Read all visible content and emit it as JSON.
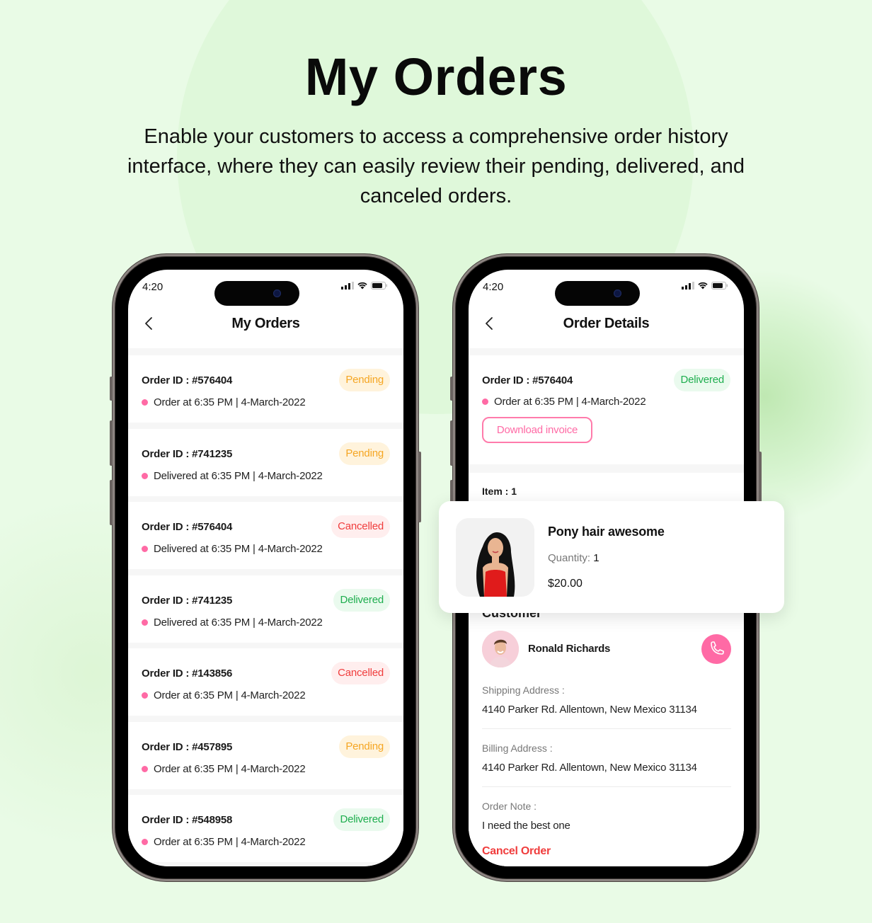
{
  "hero": {
    "title": "My Orders",
    "subtitle": "Enable your customers to access a comprehensive order history interface, where they can easily review their pending, delivered, and canceled orders."
  },
  "colors": {
    "accent_pink": "#ff6aa5",
    "pending": "#f5a623",
    "cancelled": "#f03d3d",
    "delivered": "#1fae4f",
    "background": "#e9fbe6"
  },
  "status_bar": {
    "time": "4:20",
    "icons": [
      "signal-icon",
      "wifi-icon",
      "battery-icon"
    ]
  },
  "orders_screen": {
    "title": "My Orders",
    "back_icon": "chevron-left-icon",
    "orders": [
      {
        "id_label": "Order ID : #576404",
        "meta": "Order at 6:35 PM | 4-March-2022",
        "status": "Pending",
        "status_type": "pending"
      },
      {
        "id_label": "Order ID : #741235",
        "meta": "Delivered at 6:35 PM | 4-March-2022",
        "status": "Pending",
        "status_type": "pending"
      },
      {
        "id_label": "Order ID : #576404",
        "meta": "Delivered at 6:35 PM | 4-March-2022",
        "status": "Cancelled",
        "status_type": "cancelled"
      },
      {
        "id_label": "Order ID : #741235",
        "meta": "Delivered at 6:35 PM | 4-March-2022",
        "status": "Delivered",
        "status_type": "delivered"
      },
      {
        "id_label": "Order ID : #143856",
        "meta": "Order at 6:35 PM | 4-March-2022",
        "status": "Cancelled",
        "status_type": "cancelled"
      },
      {
        "id_label": "Order ID : #457895",
        "meta": "Order at 6:35 PM | 4-March-2022",
        "status": "Pending",
        "status_type": "pending"
      },
      {
        "id_label": "Order ID : #548958",
        "meta": "Order at 6:35 PM | 4-March-2022",
        "status": "Delivered",
        "status_type": "delivered"
      }
    ]
  },
  "details_screen": {
    "title": "Order Details",
    "back_icon": "chevron-left-icon",
    "order_id_label": "Order ID : #576404",
    "order_meta": "Order at 6:35 PM | 4-March-2022",
    "status": "Delivered",
    "download_invoice_label": "Download invoice",
    "items_label": "Item : 1",
    "product": {
      "name": "Pony hair awesome",
      "quantity_label": "Quantity:",
      "quantity_value": "1",
      "price": "$20.00"
    },
    "customer_label": "Customer",
    "customer_name": "Ronald Richards",
    "call_icon": "phone-icon",
    "shipping_label": "Shipping Address :",
    "shipping_value": "4140 Parker Rd. Allentown, New Mexico 31134",
    "billing_label": "Billing Address :",
    "billing_value": "4140 Parker Rd. Allentown, New Mexico 31134",
    "note_label": "Order Note :",
    "note_value": "I need the best one",
    "cancel_order_label": "Cancel Order"
  }
}
